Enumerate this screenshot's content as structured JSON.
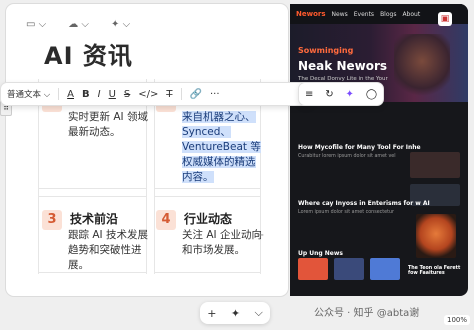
{
  "toolbar_top": {
    "dropdown_glyph": "⌵",
    "sparkle_glyph": "✦"
  },
  "doc": {
    "title": "AI 资讯",
    "cards": {
      "c1": {
        "lines": [
          "实时更新 AI 领域",
          "最新动态。"
        ]
      },
      "c2": {
        "lines": [
          "来自机器之心、",
          "Synced、",
          "VentureBeat 等",
          "权威媒体的精选",
          "内容。"
        ]
      },
      "c3": {
        "number": "3",
        "heading": "技术前沿",
        "lines": [
          "跟踪 AI 技术发展",
          "趋势和突破性进",
          "展。"
        ]
      },
      "c4": {
        "number": "4",
        "heading": "行业动态",
        "lines": [
          "关注 AI 企业动向",
          "和市场发展。"
        ]
      }
    }
  },
  "format_toolbar": {
    "style_label": "普通文本",
    "font_color_glyph": "A",
    "bold": "B",
    "italic": "I",
    "underline": "U",
    "strike": "S",
    "code": "</>",
    "clear": "T̶",
    "link": "🔗",
    "more": "···",
    "align": "≡",
    "redo": "↻",
    "ai": "✦",
    "comment": "◯"
  },
  "web_preview": {
    "brand": "Newors",
    "nav": [
      "News",
      "Events",
      "Blogs",
      "About"
    ],
    "hero_sub": "Sowminging",
    "hero_title": "Neak Newors",
    "hero_tagline": "The Decal Donvy Lite in the Your",
    "section1_title": "How Mycofile for Many Tool For Inhe",
    "section1_sub": "Curabitur lorem ipsum dolor sit amet vel",
    "section2_title": "Where cay Inyoss in Enterisms for w AI",
    "section2_sub": "Lorem ipsum dolor sit amet consectetur",
    "section3_title": "Up Ung News",
    "section4_title": "The Teon ola Ferett fow Faaitures"
  },
  "bottom": {
    "add": "+",
    "sparkle": "✦",
    "chevron": "⌵",
    "watermark": "公众号 · 知乎 @abta谢",
    "zoom": "100%"
  },
  "colors": {
    "accent": "#ff5a2d",
    "badge_bg": "#fbe1d6",
    "badge_fg": "#d55b33",
    "highlight": "#cfe0fb"
  }
}
